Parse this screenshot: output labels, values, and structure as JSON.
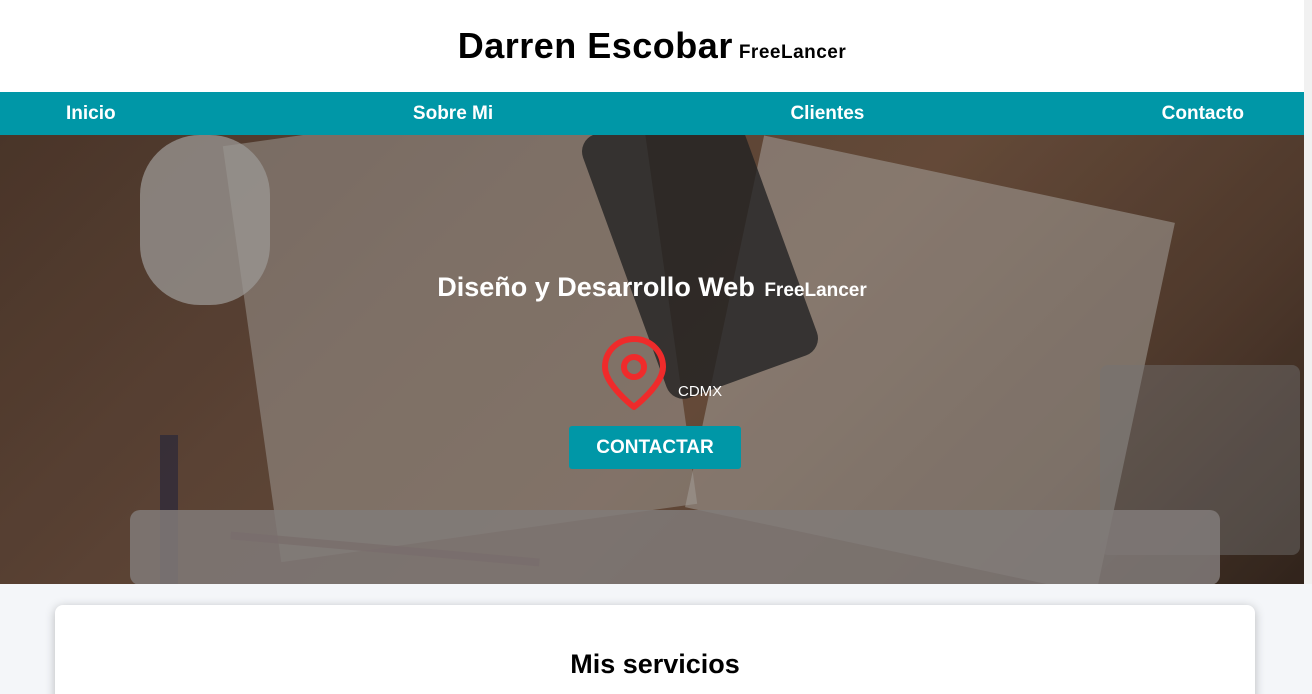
{
  "header": {
    "name": "Darren Escobar",
    "subtitle": "FreeLancer"
  },
  "nav": {
    "items": [
      {
        "label": "Inicio"
      },
      {
        "label": "Sobre Mi"
      },
      {
        "label": "Clientes"
      },
      {
        "label": "Contacto"
      }
    ]
  },
  "hero": {
    "title": "Diseño y Desarrollo Web",
    "title_sub": "FreeLancer",
    "location": "CDMX",
    "cta_label": "CONTACTAR"
  },
  "services": {
    "title": "Mis servicios"
  },
  "colors": {
    "accent": "#0097a7",
    "pin": "#ef2b2b"
  },
  "icons": {
    "location": "map-pin-icon"
  }
}
